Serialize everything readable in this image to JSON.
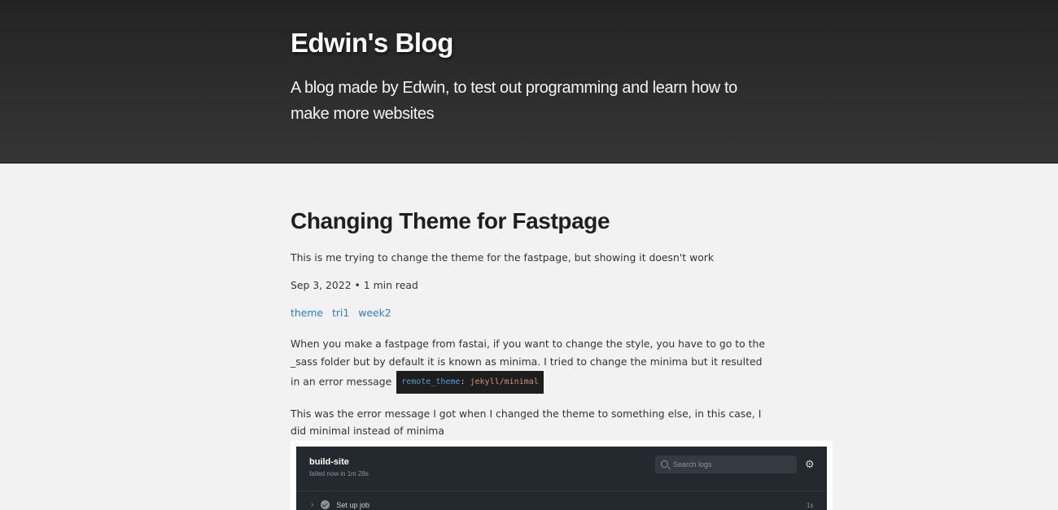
{
  "header": {
    "title": "Edwin's Blog",
    "description": "A blog made by Edwin, to test out programming and learn how to make more websites"
  },
  "post": {
    "title": "Changing Theme for Fastpage",
    "description": "This is me trying to change the theme for the fastpage, but showing it doesn't work",
    "date": "Sep 3, 2022",
    "meta_sep": " • ",
    "read_time": "1 min read",
    "tags": [
      "theme",
      "tri1",
      "week2"
    ],
    "paragraph1": "When you make a fastpage from fastai, if you want to change the style, you have to go to the _sass folder but by default it is known as minima. I tried to change the minima but it resulted in an error message ",
    "code": {
      "key": "remote_theme",
      "colon": ": ",
      "value": "jekyll/minimal"
    },
    "paragraph2": "This was the error message I got when I changed the theme to something else, in this case, I did minimal instead of minima"
  },
  "screenshot": {
    "job_title": "build-site",
    "job_status": "failed now in 1m 28s",
    "search_placeholder": "Search logs",
    "step_label": "Set up job",
    "step_time": "1s"
  }
}
